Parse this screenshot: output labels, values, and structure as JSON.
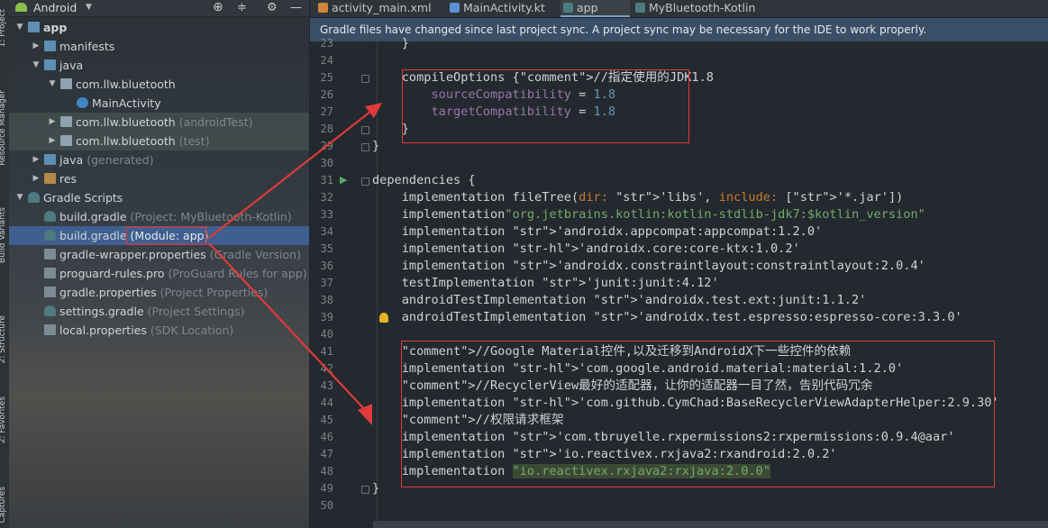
{
  "project_panel": {
    "view_mode": "Android",
    "tree": [
      {
        "label": "app",
        "hint": "",
        "depth": 0,
        "arrow": "down",
        "icon": "folder-icon"
      },
      {
        "label": "manifests",
        "hint": "",
        "depth": 1,
        "arrow": "right",
        "icon": "folder-icon"
      },
      {
        "label": "java",
        "hint": "",
        "depth": 1,
        "arrow": "down",
        "icon": "folder-icon"
      },
      {
        "label": "com.llw.bluetooth",
        "hint": "",
        "depth": 2,
        "arrow": "down",
        "icon": "package-icon"
      },
      {
        "label": "MainActivity",
        "hint": "",
        "depth": 3,
        "arrow": "",
        "icon": "kotlin-class-icon"
      },
      {
        "label": "com.llw.bluetooth",
        "hint": "(androidTest)",
        "depth": 2,
        "arrow": "right",
        "icon": "package-icon"
      },
      {
        "label": "com.llw.bluetooth",
        "hint": "(test)",
        "depth": 2,
        "arrow": "right",
        "icon": "package-icon"
      },
      {
        "label": "java",
        "hint": "(generated)",
        "depth": 1,
        "arrow": "right",
        "icon": "folder-icon"
      },
      {
        "label": "res",
        "hint": "",
        "depth": 1,
        "arrow": "right",
        "icon": "res-folder-icon"
      },
      {
        "label": "Gradle Scripts",
        "hint": "",
        "depth": 0,
        "arrow": "down",
        "icon": "gradle-icon"
      },
      {
        "label": "build.gradle",
        "hint": "(Project: MyBluetooth-Kotlin)",
        "depth": 1,
        "arrow": "",
        "icon": "gradle-icon"
      },
      {
        "label": "build.gradle",
        "hint": "(Module: app)",
        "depth": 1,
        "arrow": "",
        "icon": "gradle-icon"
      },
      {
        "label": "gradle-wrapper.properties",
        "hint": "(Gradle Version)",
        "depth": 1,
        "arrow": "",
        "icon": "properties-icon"
      },
      {
        "label": "proguard-rules.pro",
        "hint": "(ProGuard Rules for app)",
        "depth": 1,
        "arrow": "",
        "icon": "file-icon"
      },
      {
        "label": "gradle.properties",
        "hint": "(Project Properties)",
        "depth": 1,
        "arrow": "",
        "icon": "properties-icon"
      },
      {
        "label": "settings.gradle",
        "hint": "(Project Settings)",
        "depth": 1,
        "arrow": "",
        "icon": "gradle-icon"
      },
      {
        "label": "local.properties",
        "hint": "(SDK Location)",
        "depth": 1,
        "arrow": "",
        "icon": "properties-icon"
      }
    ],
    "selected_index": 11
  },
  "tool_strip": [
    "1: Project",
    "Resource Manager",
    "Build Variants",
    "2: Structure",
    "2: Favorites",
    "Captures"
  ],
  "tabs": [
    {
      "label": "activity_main.xml",
      "icon": "xml-file-icon",
      "active": false
    },
    {
      "label": "MainActivity.kt",
      "icon": "kotlin-file-icon",
      "active": false
    },
    {
      "label": "app",
      "icon": "gradle-icon",
      "active": true
    },
    {
      "label": "MyBluetooth-Kotlin",
      "icon": "gradle-icon",
      "active": false
    }
  ],
  "banner": "Gradle files have changed since last project sync. A project sync may be necessary for the IDE to work properly.",
  "code": {
    "first_line": 23,
    "lines": [
      "    }",
      "",
      "    compileOptions {//指定使用的JDK1.8",
      "        sourceCompatibility = 1.8",
      "        targetCompatibility = 1.8",
      "    }",
      "}",
      "",
      "dependencies {",
      "    implementation fileTree(dir: 'libs', include: ['*.jar'])",
      "    implementation\"org.jetbrains.kotlin:kotlin-stdlib-jdk7:$kotlin_version\"",
      "    implementation 'androidx.appcompat:appcompat:1.2.0'",
      "    implementation 'androidx.core:core-ktx:1.0.2'",
      "    implementation 'androidx.constraintlayout:constraintlayout:2.0.4'",
      "    testImplementation 'junit:junit:4.12'",
      "    androidTestImplementation 'androidx.test.ext:junit:1.1.2'",
      "    androidTestImplementation 'androidx.test.espresso:espresso-core:3.3.0'",
      "",
      "    //Google Material控件,以及迁移到AndroidX下一些控件的依赖",
      "    implementation 'com.google.android.material:material:1.2.0'",
      "    //RecyclerView最好的适配器，让你的适配器一目了然，告别代码冗余",
      "    implementation 'com.github.CymChad:BaseRecyclerViewAdapterHelper:2.9.30'",
      "    //权限请求框架",
      "    implementation 'com.tbruyelle.rxpermissions2:rxpermissions:0.9.4@aar'",
      "    implementation 'io.reactivex.rxjava2:rxandroid:2.0.2'",
      "    implementation \"io.reactivex.rxjava2:rxjava:2.0.0\"",
      "}",
      ""
    ]
  }
}
